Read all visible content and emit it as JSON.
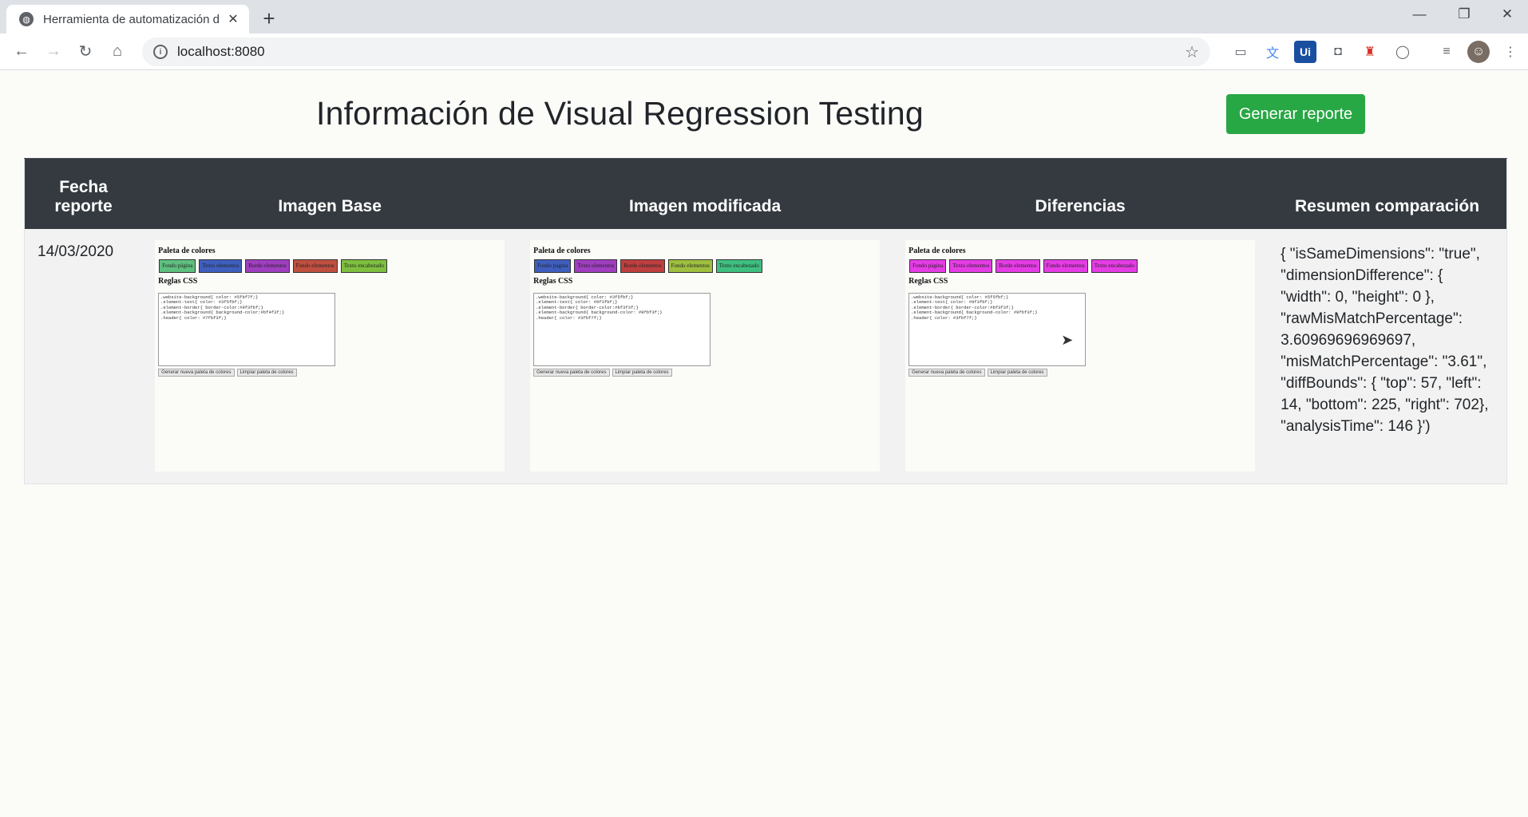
{
  "browser": {
    "tab_title": "Herramienta de automatización d",
    "url": "localhost:8080"
  },
  "page": {
    "title": "Información de Visual Regression Testing",
    "generate_button": "Generar reporte"
  },
  "table": {
    "headers": {
      "fecha_line1": "Fecha",
      "fecha_line2": "reporte",
      "base": "Imagen Base",
      "modificada": "Imagen modificada",
      "diferencias": "Diferencias",
      "resumen": "Resumen comparación"
    },
    "row": {
      "fecha": "14/03/2020",
      "resumen": "{ \"isSameDimensions\": \"true\", \"dimensionDifference\": { \"width\": 0, \"height\": 0 }, \"rawMisMatchPercentage\": 3.60969696969697, \"misMatchPercentage\": \"3.61\", \"diffBounds\": { \"top\": 57, \"left\": 14, \"bottom\": 225, \"right\": 702}, \"analysisTime\": 146 }')"
    }
  },
  "screenshots": {
    "heading_palette": "Paleta de colores",
    "heading_rules": "Reglas CSS",
    "btn_generate": "Generar nueva paleta de colores",
    "btn_clear": "Limpiar paleta de colores",
    "base": {
      "swatches": [
        {
          "label": "Fondo página",
          "color": "#5fbf7f"
        },
        {
          "label": "Texto elementos",
          "color": "#3f5fbf"
        },
        {
          "label": "Borde elementos",
          "color": "#9f3fbf"
        },
        {
          "label": "Fondo elementos",
          "color": "#bf4f3f"
        },
        {
          "label": "Texto encabezado",
          "color": "#7fbf3f"
        }
      ],
      "css": ".website-background{ color: #5fbf7f;}\n.element-text{ color: #3f5fbf;}\n.element-border{ border-color:#9f3fbf;}\n.element-background{ background-color:#bf4f3f;}\n.header{ color: #7fbf3f;}"
    },
    "modified": {
      "swatches": [
        {
          "label": "Fondo página",
          "color": "#3f5fbf"
        },
        {
          "label": "Texto elementos",
          "color": "#9f3fbf"
        },
        {
          "label": "Borde elementos",
          "color": "#bf3f3f"
        },
        {
          "label": "Fondo elementos",
          "color": "#9fbf3f"
        },
        {
          "label": "Texto encabezado",
          "color": "#3fbf7f"
        }
      ],
      "css": ".website-background{ color: #3f5fbf;}\n.element-text{ color: #9f3fbf;}\n.element-border{ border-color:#bf3f3f;}\n.element-background{ background-color: #9fbf3f;}\n.header{ color: #3fbf7f;}"
    },
    "diff": {
      "swatches": [
        {
          "label": "Fondo página",
          "color": "#e63ce6"
        },
        {
          "label": "Texto elementos",
          "color": "#e63ce6"
        },
        {
          "label": "Borde elementos",
          "color": "#e63ce6"
        },
        {
          "label": "Fondo elementos",
          "color": "#e63ce6"
        },
        {
          "label": "Texto encabezado",
          "color": "#e63ce6"
        }
      ],
      "css": ".website-background{ color: #5f5fbf;}\n.element-text{ color: #9f3fbf;}\n.element-border{ border-color:#bf3f3f;}\n.element-background{ background-color: #9fbf3f;}\n.header{ color: #3fbf7f;}"
    }
  },
  "colors": {
    "header_bg": "#343a40",
    "success": "#28a745"
  }
}
